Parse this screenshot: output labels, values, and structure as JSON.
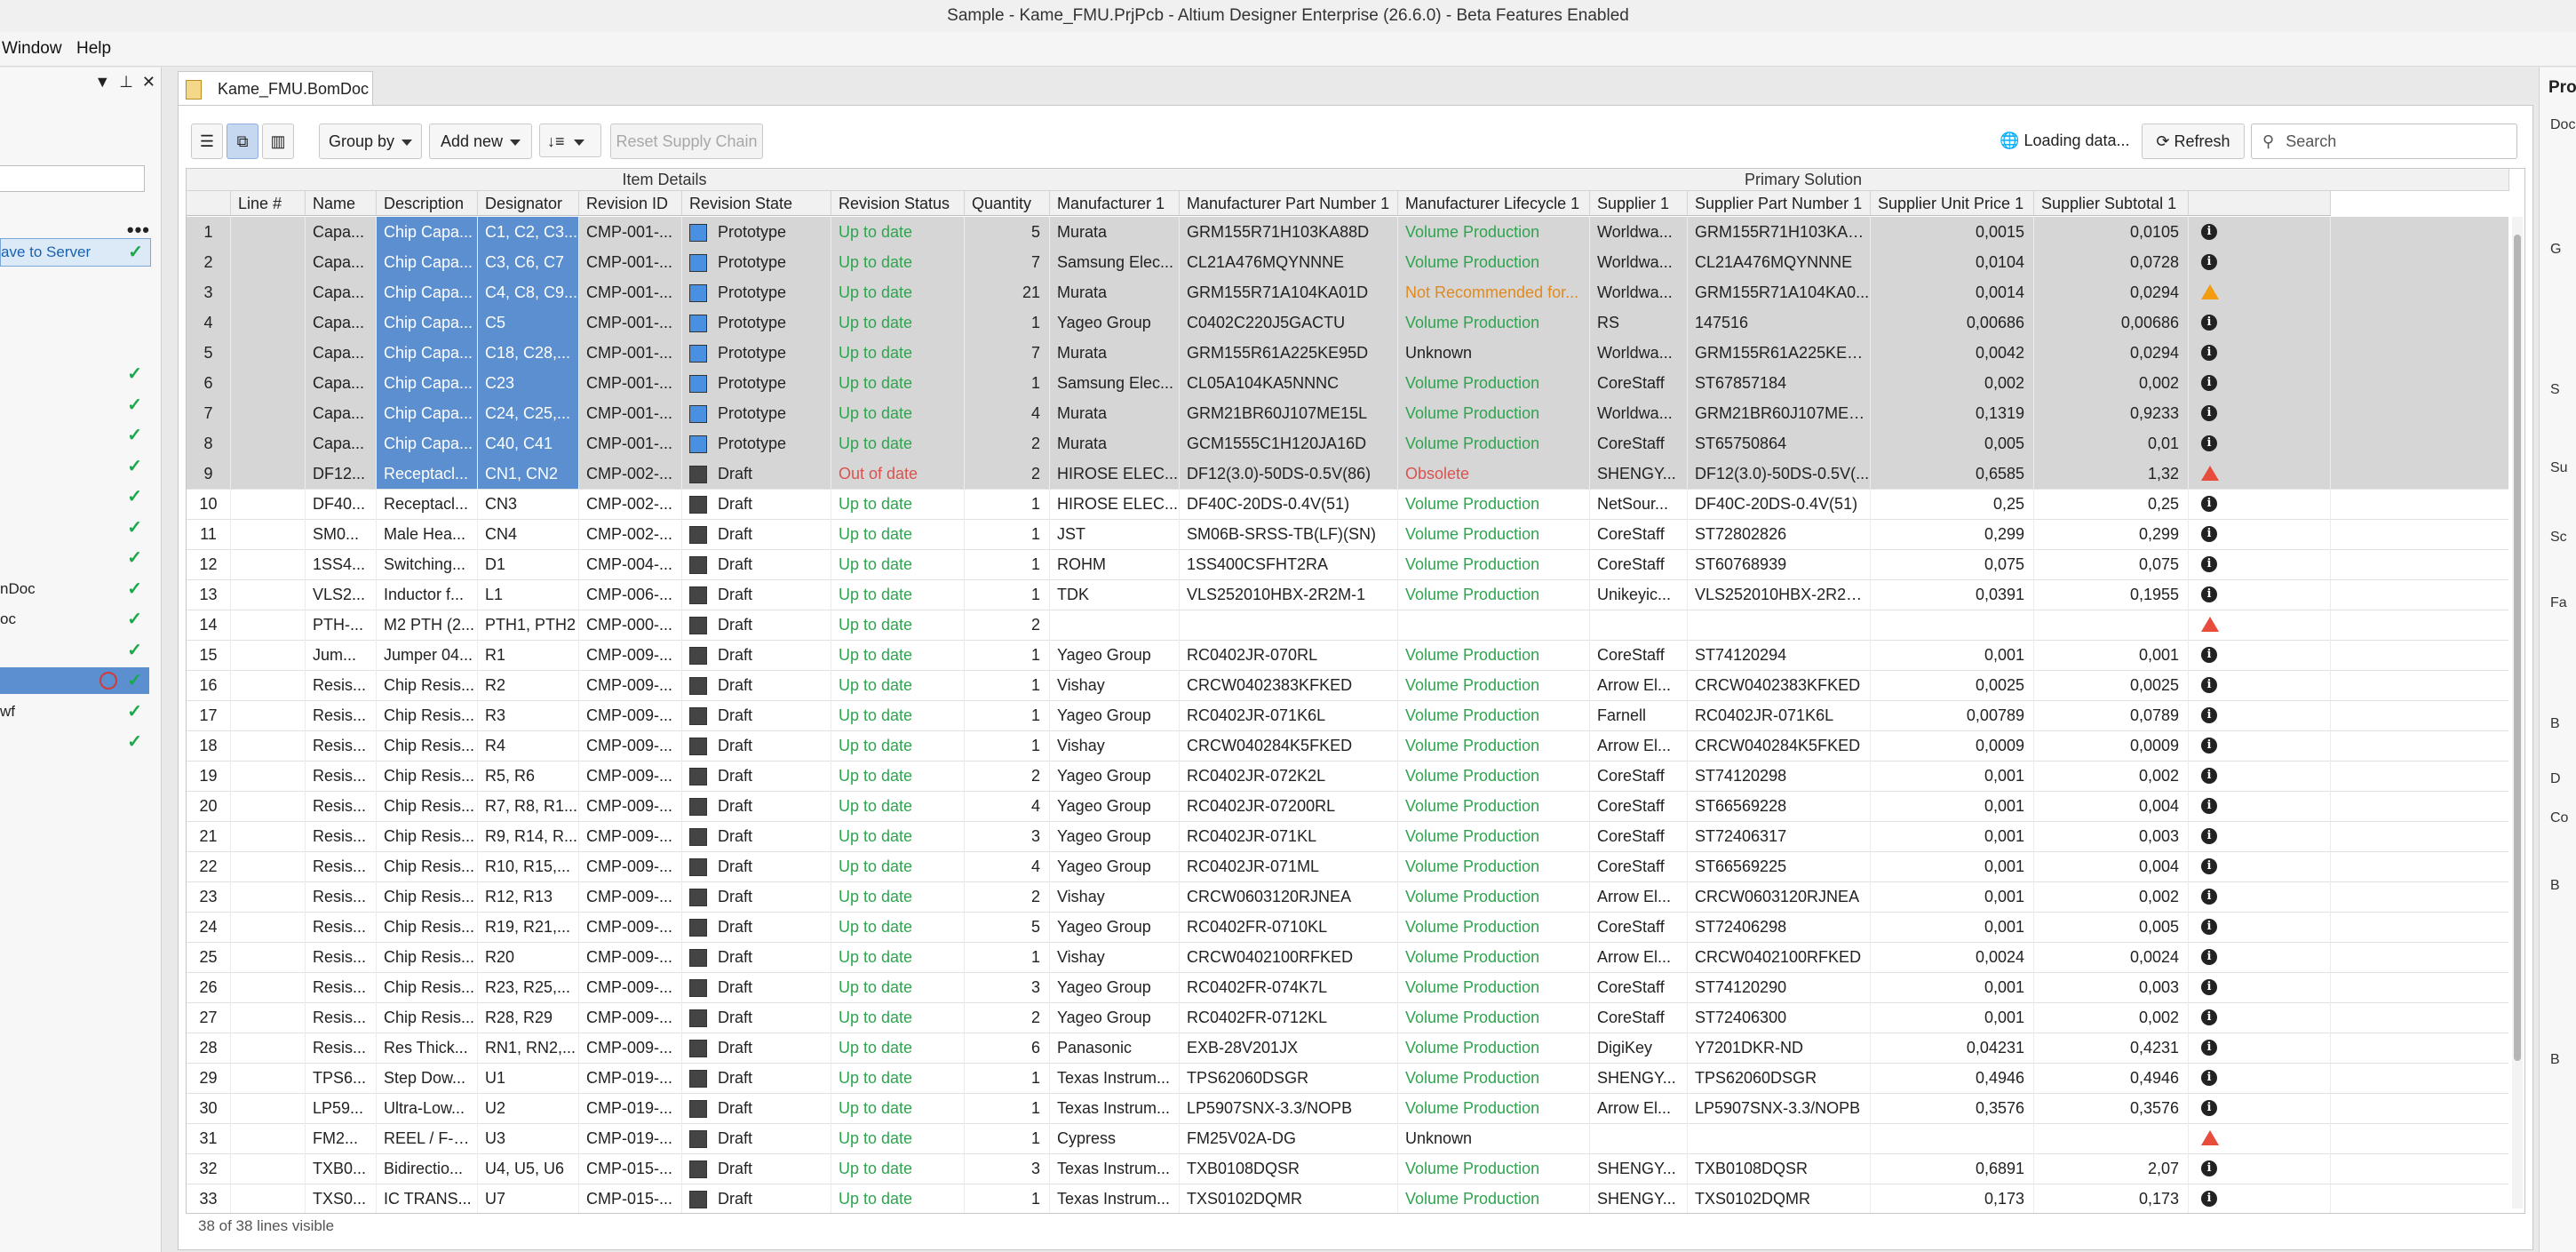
{
  "window": {
    "title": "Sample - Kame_FMU.PrjPcb - Altium Designer Enterprise (26.6.0) - Beta Features Enabled"
  },
  "menu": {
    "items": [
      "Window",
      "Help"
    ]
  },
  "left_panel": {
    "tool_glyphs": [
      "▼",
      "⊥",
      "✕"
    ],
    "more_glyph": "•••",
    "ok_glyph": "✓",
    "rows": [
      {
        "label": "ave to Server",
        "ok": true,
        "style": "saveserver"
      },
      {
        "label": "",
        "ok": false
      },
      {
        "label": "",
        "ok": false
      },
      {
        "label": "",
        "ok": false
      },
      {
        "label": "",
        "ok": true
      },
      {
        "label": "",
        "ok": true
      },
      {
        "label": "",
        "ok": true
      },
      {
        "label": "",
        "ok": true
      },
      {
        "label": "",
        "ok": true
      },
      {
        "label": "",
        "ok": true
      },
      {
        "label": "",
        "ok": true
      },
      {
        "label": "nDoc",
        "ok": true
      },
      {
        "label": "oc",
        "ok": true
      },
      {
        "label": "",
        "ok": true
      },
      {
        "label": "",
        "ok": true,
        "style": "selected"
      },
      {
        "label": "wf",
        "ok": true
      },
      {
        "label": "",
        "ok": true
      }
    ]
  },
  "right_panel": {
    "title": "Proj",
    "labels": [
      "Doc",
      "G",
      "S",
      "Su",
      "Sc",
      "Fa",
      "B",
      "D",
      "Co",
      "B",
      "B"
    ]
  },
  "tab": {
    "label": "Kame_FMU.BomDoc *"
  },
  "toolbar": {
    "view_icons": [
      "☰",
      "⧉",
      "▥"
    ],
    "group_by": "Group by",
    "add_new": "Add new",
    "sort_icon": "↓≡",
    "reset_supply_chain": "Reset Supply Chain",
    "loading": "Loading data...",
    "loading_icon": "🌐",
    "refresh": "Refresh",
    "refresh_icon": "⟳",
    "search_placeholder": "Search",
    "search_icon": "⚲"
  },
  "grid": {
    "group_headers": [
      "Item Details",
      "Primary Solution"
    ],
    "columns": [
      "",
      "Line #",
      "Name",
      "Description",
      "Designator",
      "Revision ID",
      "Revision State",
      "Revision Status",
      "Quantity",
      "Manufacturer 1",
      "Manufacturer Part Number 1",
      "Manufacturer Lifecycle 1",
      "Supplier 1",
      "Supplier Part Number 1",
      "Supplier Unit Price 1",
      "Supplier Subtotal 1",
      ""
    ],
    "rows": [
      {
        "n": "1",
        "line": "",
        "name": "Capa...",
        "desc": "Chip Capa...",
        "des": "C1, C2, C3...",
        "rev": "CMP-001-...",
        "state": "Prototype",
        "status": "Up to date",
        "qty": "5",
        "mfr": "Murata",
        "mpn": "GRM155R71H103KA88D",
        "life": "Volume Production",
        "sup": "Worldwa...",
        "spn": "GRM155R71H103KA8...",
        "price": "0,0015",
        "sub": "0,0105",
        "icon": "info",
        "sel": true
      },
      {
        "n": "2",
        "line": "",
        "name": "Capa...",
        "desc": "Chip Capa...",
        "des": "C3, C6, C7",
        "rev": "CMP-001-...",
        "state": "Prototype",
        "status": "Up to date",
        "qty": "7",
        "mfr": "Samsung Elec...",
        "mpn": "CL21A476MQYNNNE",
        "life": "Volume Production",
        "sup": "Worldwa...",
        "spn": "CL21A476MQYNNNE",
        "price": "0,0104",
        "sub": "0,0728",
        "icon": "info",
        "sel": true
      },
      {
        "n": "3",
        "line": "",
        "name": "Capa...",
        "desc": "Chip Capa...",
        "des": "C4, C8, C9...",
        "rev": "CMP-001-...",
        "state": "Prototype",
        "status": "Up to date",
        "qty": "21",
        "mfr": "Murata",
        "mpn": "GRM155R71A104KA01D",
        "life": "Not Recommended for...",
        "sup": "Worldwa...",
        "spn": "GRM155R71A104KA0...",
        "price": "0,0014",
        "sub": "0,0294",
        "icon": "warn-orange",
        "sel": true
      },
      {
        "n": "4",
        "line": "",
        "name": "Capa...",
        "desc": "Chip Capa...",
        "des": "C5",
        "rev": "CMP-001-...",
        "state": "Prototype",
        "status": "Up to date",
        "qty": "1",
        "mfr": "Yageo Group",
        "mpn": "C0402C220J5GACTU",
        "life": "Volume Production",
        "sup": "RS",
        "spn": "147516",
        "price": "0,00686",
        "sub": "0,00686",
        "icon": "info",
        "sel": true
      },
      {
        "n": "5",
        "line": "",
        "name": "Capa...",
        "desc": "Chip Capa...",
        "des": "C18, C28,...",
        "rev": "CMP-001-...",
        "state": "Prototype",
        "status": "Up to date",
        "qty": "7",
        "mfr": "Murata",
        "mpn": "GRM155R61A225KE95D",
        "life": "Unknown",
        "sup": "Worldwa...",
        "spn": "GRM155R61A225KE95D",
        "price": "0,0042",
        "sub": "0,0294",
        "icon": "info",
        "sel": true
      },
      {
        "n": "6",
        "line": "",
        "name": "Capa...",
        "desc": "Chip Capa...",
        "des": "C23",
        "rev": "CMP-001-...",
        "state": "Prototype",
        "status": "Up to date",
        "qty": "1",
        "mfr": "Samsung Elec...",
        "mpn": "CL05A104KA5NNNC",
        "life": "Volume Production",
        "sup": "CoreStaff",
        "spn": "ST67857184",
        "price": "0,002",
        "sub": "0,002",
        "icon": "info",
        "sel": true
      },
      {
        "n": "7",
        "line": "",
        "name": "Capa...",
        "desc": "Chip Capa...",
        "des": "C24, C25,...",
        "rev": "CMP-001-...",
        "state": "Prototype",
        "status": "Up to date",
        "qty": "4",
        "mfr": "Murata",
        "mpn": "GRM21BR60J107ME15L",
        "life": "Volume Production",
        "sup": "Worldwa...",
        "spn": "GRM21BR60J107ME15L",
        "price": "0,1319",
        "sub": "0,9233",
        "icon": "info",
        "sel": true
      },
      {
        "n": "8",
        "line": "",
        "name": "Capa...",
        "desc": "Chip Capa...",
        "des": "C40, C41",
        "rev": "CMP-001-...",
        "state": "Prototype",
        "status": "Up to date",
        "qty": "2",
        "mfr": "Murata",
        "mpn": "GCM1555C1H120JA16D",
        "life": "Volume Production",
        "sup": "CoreStaff",
        "spn": "ST65750864",
        "price": "0,005",
        "sub": "0,01",
        "icon": "info",
        "sel": true
      },
      {
        "n": "9",
        "line": "",
        "name": "DF12...",
        "desc": "Receptacl...",
        "des": "CN1, CN2",
        "rev": "CMP-002-...",
        "state": "Draft",
        "status": "Out of date",
        "qty": "2",
        "mfr": "HIROSE ELEC...",
        "mpn": "DF12(3.0)-50DS-0.5V(86)",
        "life": "Obsolete",
        "sup": "SHENGY...",
        "spn": "DF12(3.0)-50DS-0.5V(...",
        "price": "0,6585",
        "sub": "1,32",
        "icon": "warn",
        "sel": true
      },
      {
        "n": "10",
        "line": "",
        "name": "DF40...",
        "desc": "Receptacl...",
        "des": "CN3",
        "rev": "CMP-002-...",
        "state": "Draft",
        "status": "Up to date",
        "qty": "1",
        "mfr": "HIROSE ELEC...",
        "mpn": "DF40C-20DS-0.4V(51)",
        "life": "Volume Production",
        "sup": "NetSour...",
        "spn": "DF40C-20DS-0.4V(51)",
        "price": "0,25",
        "sub": "0,25",
        "icon": "info"
      },
      {
        "n": "11",
        "line": "",
        "name": "SM0...",
        "desc": "Male Hea...",
        "des": "CN4",
        "rev": "CMP-002-...",
        "state": "Draft",
        "status": "Up to date",
        "qty": "1",
        "mfr": "JST",
        "mpn": "SM06B-SRSS-TB(LF)(SN)",
        "life": "Volume Production",
        "sup": "CoreStaff",
        "spn": "ST72802826",
        "price": "0,299",
        "sub": "0,299",
        "icon": "info"
      },
      {
        "n": "12",
        "line": "",
        "name": "1SS4...",
        "desc": "Switching...",
        "des": "D1",
        "rev": "CMP-004-...",
        "state": "Draft",
        "status": "Up to date",
        "qty": "1",
        "mfr": "ROHM",
        "mpn": "1SS400CSFHT2RA",
        "life": "Volume Production",
        "sup": "CoreStaff",
        "spn": "ST60768939",
        "price": "0,075",
        "sub": "0,075",
        "icon": "info"
      },
      {
        "n": "13",
        "line": "",
        "name": "VLS2...",
        "desc": "Inductor f...",
        "des": "L1",
        "rev": "CMP-006-...",
        "state": "Draft",
        "status": "Up to date",
        "qty": "1",
        "mfr": "TDK",
        "mpn": "VLS252010HBX-2R2M-1",
        "life": "Volume Production",
        "sup": "Unikeyic...",
        "spn": "VLS252010HBX-2R2M-1",
        "price": "0,0391",
        "sub": "0,1955",
        "icon": "info"
      },
      {
        "n": "14",
        "line": "",
        "name": "PTH-...",
        "desc": "M2 PTH (2...",
        "des": "PTH1, PTH2",
        "rev": "CMP-000-...",
        "state": "Draft",
        "status": "Up to date",
        "qty": "2",
        "mfr": "",
        "mpn": "",
        "life": "",
        "sup": "",
        "spn": "",
        "price": "",
        "sub": "",
        "icon": "warn"
      },
      {
        "n": "15",
        "line": "",
        "name": "Jum...",
        "desc": "Jumper 04...",
        "des": "R1",
        "rev": "CMP-009-...",
        "state": "Draft",
        "status": "Up to date",
        "qty": "1",
        "mfr": "Yageo Group",
        "mpn": "RC0402JR-070RL",
        "life": "Volume Production",
        "sup": "CoreStaff",
        "spn": "ST74120294",
        "price": "0,001",
        "sub": "0,001",
        "icon": "info"
      },
      {
        "n": "16",
        "line": "",
        "name": "Resis...",
        "desc": "Chip Resis...",
        "des": "R2",
        "rev": "CMP-009-...",
        "state": "Draft",
        "status": "Up to date",
        "qty": "1",
        "mfr": "Vishay",
        "mpn": "CRCW0402383KFKED",
        "life": "Volume Production",
        "sup": "Arrow El...",
        "spn": "CRCW0402383KFKED",
        "price": "0,0025",
        "sub": "0,0025",
        "icon": "info"
      },
      {
        "n": "17",
        "line": "",
        "name": "Resis...",
        "desc": "Chip Resis...",
        "des": "R3",
        "rev": "CMP-009-...",
        "state": "Draft",
        "status": "Up to date",
        "qty": "1",
        "mfr": "Yageo Group",
        "mpn": "RC0402JR-071K6L",
        "life": "Volume Production",
        "sup": "Farnell",
        "spn": "RC0402JR-071K6L",
        "price": "0,00789",
        "sub": "0,0789",
        "icon": "info"
      },
      {
        "n": "18",
        "line": "",
        "name": "Resis...",
        "desc": "Chip Resis...",
        "des": "R4",
        "rev": "CMP-009-...",
        "state": "Draft",
        "status": "Up to date",
        "qty": "1",
        "mfr": "Vishay",
        "mpn": "CRCW040284K5FKED",
        "life": "Volume Production",
        "sup": "Arrow El...",
        "spn": "CRCW040284K5FKED",
        "price": "0,0009",
        "sub": "0,0009",
        "icon": "info"
      },
      {
        "n": "19",
        "line": "",
        "name": "Resis...",
        "desc": "Chip Resis...",
        "des": "R5, R6",
        "rev": "CMP-009-...",
        "state": "Draft",
        "status": "Up to date",
        "qty": "2",
        "mfr": "Yageo Group",
        "mpn": "RC0402JR-072K2L",
        "life": "Volume Production",
        "sup": "CoreStaff",
        "spn": "ST74120298",
        "price": "0,001",
        "sub": "0,002",
        "icon": "info"
      },
      {
        "n": "20",
        "line": "",
        "name": "Resis...",
        "desc": "Chip Resis...",
        "des": "R7, R8, R1...",
        "rev": "CMP-009-...",
        "state": "Draft",
        "status": "Up to date",
        "qty": "4",
        "mfr": "Yageo Group",
        "mpn": "RC0402JR-07200RL",
        "life": "Volume Production",
        "sup": "CoreStaff",
        "spn": "ST66569228",
        "price": "0,001",
        "sub": "0,004",
        "icon": "info"
      },
      {
        "n": "21",
        "line": "",
        "name": "Resis...",
        "desc": "Chip Resis...",
        "des": "R9, R14, R...",
        "rev": "CMP-009-...",
        "state": "Draft",
        "status": "Up to date",
        "qty": "3",
        "mfr": "Yageo Group",
        "mpn": "RC0402JR-071KL",
        "life": "Volume Production",
        "sup": "CoreStaff",
        "spn": "ST72406317",
        "price": "0,001",
        "sub": "0,003",
        "icon": "info"
      },
      {
        "n": "22",
        "line": "",
        "name": "Resis...",
        "desc": "Chip Resis...",
        "des": "R10, R15,...",
        "rev": "CMP-009-...",
        "state": "Draft",
        "status": "Up to date",
        "qty": "4",
        "mfr": "Yageo Group",
        "mpn": "RC0402JR-071ML",
        "life": "Volume Production",
        "sup": "CoreStaff",
        "spn": "ST66569225",
        "price": "0,001",
        "sub": "0,004",
        "icon": "info"
      },
      {
        "n": "23",
        "line": "",
        "name": "Resis...",
        "desc": "Chip Resis...",
        "des": "R12, R13",
        "rev": "CMP-009-...",
        "state": "Draft",
        "status": "Up to date",
        "qty": "2",
        "mfr": "Vishay",
        "mpn": "CRCW0603120RJNEA",
        "life": "Volume Production",
        "sup": "Arrow El...",
        "spn": "CRCW0603120RJNEA",
        "price": "0,001",
        "sub": "0,002",
        "icon": "info"
      },
      {
        "n": "24",
        "line": "",
        "name": "Resis...",
        "desc": "Chip Resis...",
        "des": "R19, R21,...",
        "rev": "CMP-009-...",
        "state": "Draft",
        "status": "Up to date",
        "qty": "5",
        "mfr": "Yageo Group",
        "mpn": "RC0402FR-0710KL",
        "life": "Volume Production",
        "sup": "CoreStaff",
        "spn": "ST72406298",
        "price": "0,001",
        "sub": "0,005",
        "icon": "info"
      },
      {
        "n": "25",
        "line": "",
        "name": "Resis...",
        "desc": "Chip Resis...",
        "des": "R20",
        "rev": "CMP-009-...",
        "state": "Draft",
        "status": "Up to date",
        "qty": "1",
        "mfr": "Vishay",
        "mpn": "CRCW0402100RFKED",
        "life": "Volume Production",
        "sup": "Arrow El...",
        "spn": "CRCW0402100RFKED",
        "price": "0,0024",
        "sub": "0,0024",
        "icon": "info"
      },
      {
        "n": "26",
        "line": "",
        "name": "Resis...",
        "desc": "Chip Resis...",
        "des": "R23, R25,...",
        "rev": "CMP-009-...",
        "state": "Draft",
        "status": "Up to date",
        "qty": "3",
        "mfr": "Yageo Group",
        "mpn": "RC0402FR-074K7L",
        "life": "Volume Production",
        "sup": "CoreStaff",
        "spn": "ST74120290",
        "price": "0,001",
        "sub": "0,003",
        "icon": "info"
      },
      {
        "n": "27",
        "line": "",
        "name": "Resis...",
        "desc": "Chip Resis...",
        "des": "R28, R29",
        "rev": "CMP-009-...",
        "state": "Draft",
        "status": "Up to date",
        "qty": "2",
        "mfr": "Yageo Group",
        "mpn": "RC0402FR-0712KL",
        "life": "Volume Production",
        "sup": "CoreStaff",
        "spn": "ST72406300",
        "price": "0,001",
        "sub": "0,002",
        "icon": "info"
      },
      {
        "n": "28",
        "line": "",
        "name": "Resis...",
        "desc": "Res Thick...",
        "des": "RN1, RN2,...",
        "rev": "CMP-009-...",
        "state": "Draft",
        "status": "Up to date",
        "qty": "6",
        "mfr": "Panasonic",
        "mpn": "EXB-28V201JX",
        "life": "Volume Production",
        "sup": "DigiKey",
        "spn": "Y7201DKR-ND",
        "price": "0,04231",
        "sub": "0,4231",
        "icon": "info"
      },
      {
        "n": "29",
        "line": "",
        "name": "TPS6...",
        "desc": "Step Dow...",
        "des": "U1",
        "rev": "CMP-019-...",
        "state": "Draft",
        "status": "Up to date",
        "qty": "1",
        "mfr": "Texas Instrum...",
        "mpn": "TPS62060DSGR",
        "life": "Volume Production",
        "sup": "SHENGY...",
        "spn": "TPS62060DSGR",
        "price": "0,4946",
        "sub": "0,4946",
        "icon": "info"
      },
      {
        "n": "30",
        "line": "",
        "name": "LP59...",
        "desc": "Ultra-Low...",
        "des": "U2",
        "rev": "CMP-019-...",
        "state": "Draft",
        "status": "Up to date",
        "qty": "1",
        "mfr": "Texas Instrum...",
        "mpn": "LP5907SNX-3.3/NOPB",
        "life": "Volume Production",
        "sup": "Arrow El...",
        "spn": "LP5907SNX-3.3/NOPB",
        "price": "0,3576",
        "sub": "0,3576",
        "icon": "info"
      },
      {
        "n": "31",
        "line": "",
        "name": "FM2...",
        "desc": "REEL / F-R...",
        "des": "U3",
        "rev": "CMP-019-...",
        "state": "Draft",
        "status": "Up to date",
        "qty": "1",
        "mfr": "Cypress",
        "mpn": "FM25V02A-DG",
        "life": "Unknown",
        "sup": "",
        "spn": "",
        "price": "",
        "sub": "",
        "icon": "warn"
      },
      {
        "n": "32",
        "line": "",
        "name": "TXB0...",
        "desc": "Bidirectio...",
        "des": "U4, U5, U6",
        "rev": "CMP-015-...",
        "state": "Draft",
        "status": "Up to date",
        "qty": "3",
        "mfr": "Texas Instrum...",
        "mpn": "TXB0108DQSR",
        "life": "Volume Production",
        "sup": "SHENGY...",
        "spn": "TXB0108DQSR",
        "price": "0,6891",
        "sub": "2,07",
        "icon": "info"
      },
      {
        "n": "33",
        "line": "",
        "name": "TXS0...",
        "desc": "IC TRANS...",
        "des": "U7",
        "rev": "CMP-015-...",
        "state": "Draft",
        "status": "Up to date",
        "qty": "1",
        "mfr": "Texas Instrum...",
        "mpn": "TXS0102DQMR",
        "life": "Volume Production",
        "sup": "SHENGY...",
        "spn": "TXS0102DQMR",
        "price": "0,173",
        "sub": "0,173",
        "icon": "info"
      }
    ],
    "footer": "38 of 38 lines visible"
  },
  "colors": {
    "selection": "#5b8fd0",
    "ok_green": "#2ea44f",
    "error_red": "#d9534f",
    "warning_orange": "#e08a1e"
  }
}
